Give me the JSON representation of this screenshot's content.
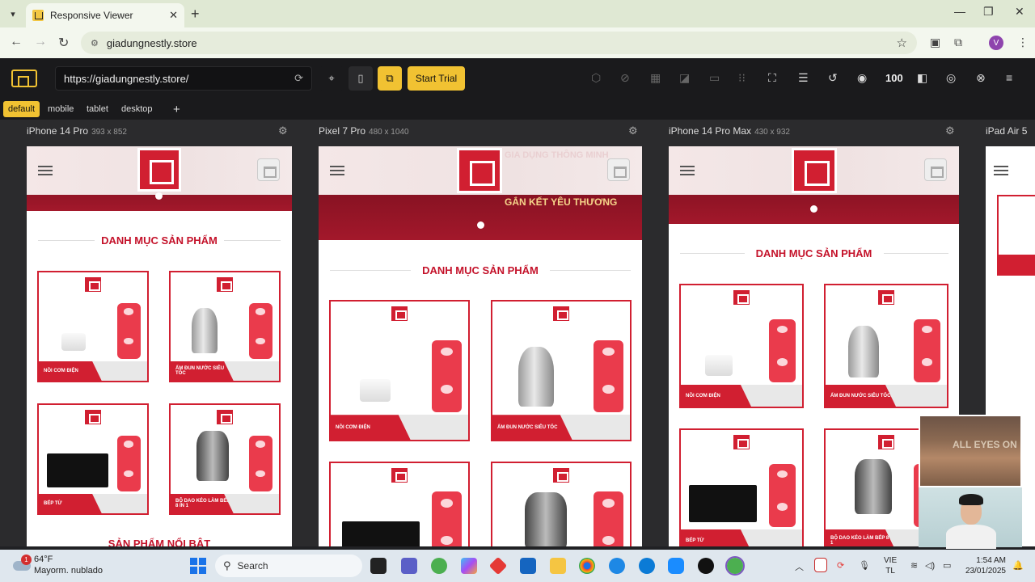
{
  "browser": {
    "tab_title": "Responsive Viewer",
    "address": "giadungnestly.store",
    "profile_initial": "V"
  },
  "viewer": {
    "url": "https://giadungnestly.store/",
    "start_trial": "Start Trial",
    "zoom": "100",
    "device_tabs": [
      "default",
      "mobile",
      "tablet",
      "desktop"
    ],
    "add_tab": "+"
  },
  "devices": [
    {
      "name": "iPhone 14 Pro",
      "size": "393 x 852"
    },
    {
      "name": "Pixel 7 Pro",
      "size": "480 x 1040"
    },
    {
      "name": "iPhone 14 Pro Max",
      "size": "430 x 932"
    },
    {
      "name": "iPad Air 5",
      "size": ""
    }
  ],
  "site": {
    "section_title": "DANH MỤC SẢN PHẨM",
    "slogan": "GẮN KẾT YÊU THƯƠNG",
    "slogan_top": "GIA DỤNG THÔNG MINH",
    "featured": "SẢN PHẨM NỔI BẬT",
    "products": [
      {
        "label": "NỒI CƠM ĐIỆN"
      },
      {
        "label": "ẤM ĐUN NƯỚC SIÊU TỐC"
      },
      {
        "label": "BẾP TỪ"
      },
      {
        "label": "BỘ DAO KÉO LÀM BẾP 8 IN 1"
      }
    ]
  },
  "webcam": {
    "overlay_text": "ALL EYES ON"
  },
  "taskbar": {
    "weather_temp": "64°F",
    "weather_desc": "Mayorm. nublado",
    "weather_badge": "1",
    "search": "Search",
    "lang_top": "VIE",
    "lang_bottom": "TL",
    "time": "1:54 AM",
    "date": "23/01/2025"
  },
  "colors": {
    "accent": "#f1c232",
    "brand": "#d11f31"
  }
}
